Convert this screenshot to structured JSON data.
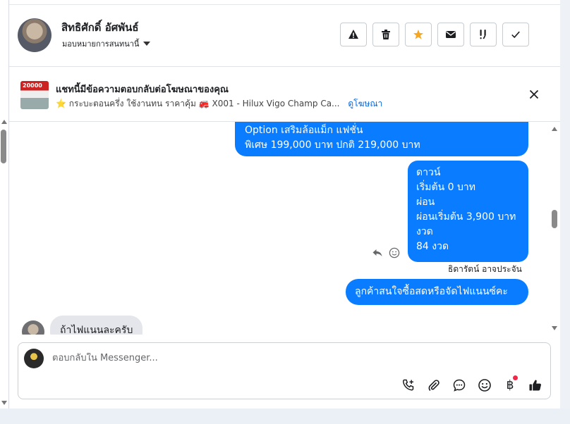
{
  "header": {
    "name": "สิทธิศักดิ์ อัศพันธ์",
    "assign_label": "มอบหมายการสนทนานี้",
    "actions": [
      {
        "icon": "warning-icon"
      },
      {
        "icon": "trash-icon"
      },
      {
        "icon": "star-icon"
      },
      {
        "icon": "envelope-icon"
      },
      {
        "icon": "follow-up-icon"
      },
      {
        "icon": "check-icon"
      }
    ]
  },
  "ad": {
    "thumb_text": "20000",
    "title": "แชทนี้มีข้อความตอบกลับต่อโฆษณาของคุณ",
    "subtitle": "⭐ กระบะตอนครึ่ง ใช้งานทน ราคาคุ้ม 🚒 X001 - Hilux Vigo Champ Ca...",
    "link": "ดูโฆษณา"
  },
  "messages": {
    "m1": [
      "Option เสริมล้อแม็ก แฟชั่น",
      "พิเศษ 199,000 บาท  ปกติ 219,000 บาท"
    ],
    "m2": [
      "ดาวน์",
      "เริ่มต้น 0 บาท",
      "ผ่อน",
      "ผ่อนเริ่มต้น 3,900 บาท",
      "งวด",
      "84 งวด"
    ],
    "sender": "ธิดารัตน์ อาจประจัน",
    "m3": "ลูกค้าสนใจซื้อสดหรือจัดไฟแนนซ์คะ",
    "incoming": "ถ้าไฟแนนละครับ"
  },
  "composer": {
    "placeholder": "ตอบกลับใน Messenger...",
    "value": "",
    "baht_symbol": "฿"
  },
  "colors": {
    "outgoing_bubble": "#0a7cff",
    "incoming_bubble": "#e4e6eb",
    "star": "#f5a623",
    "link": "#0a66d9"
  }
}
